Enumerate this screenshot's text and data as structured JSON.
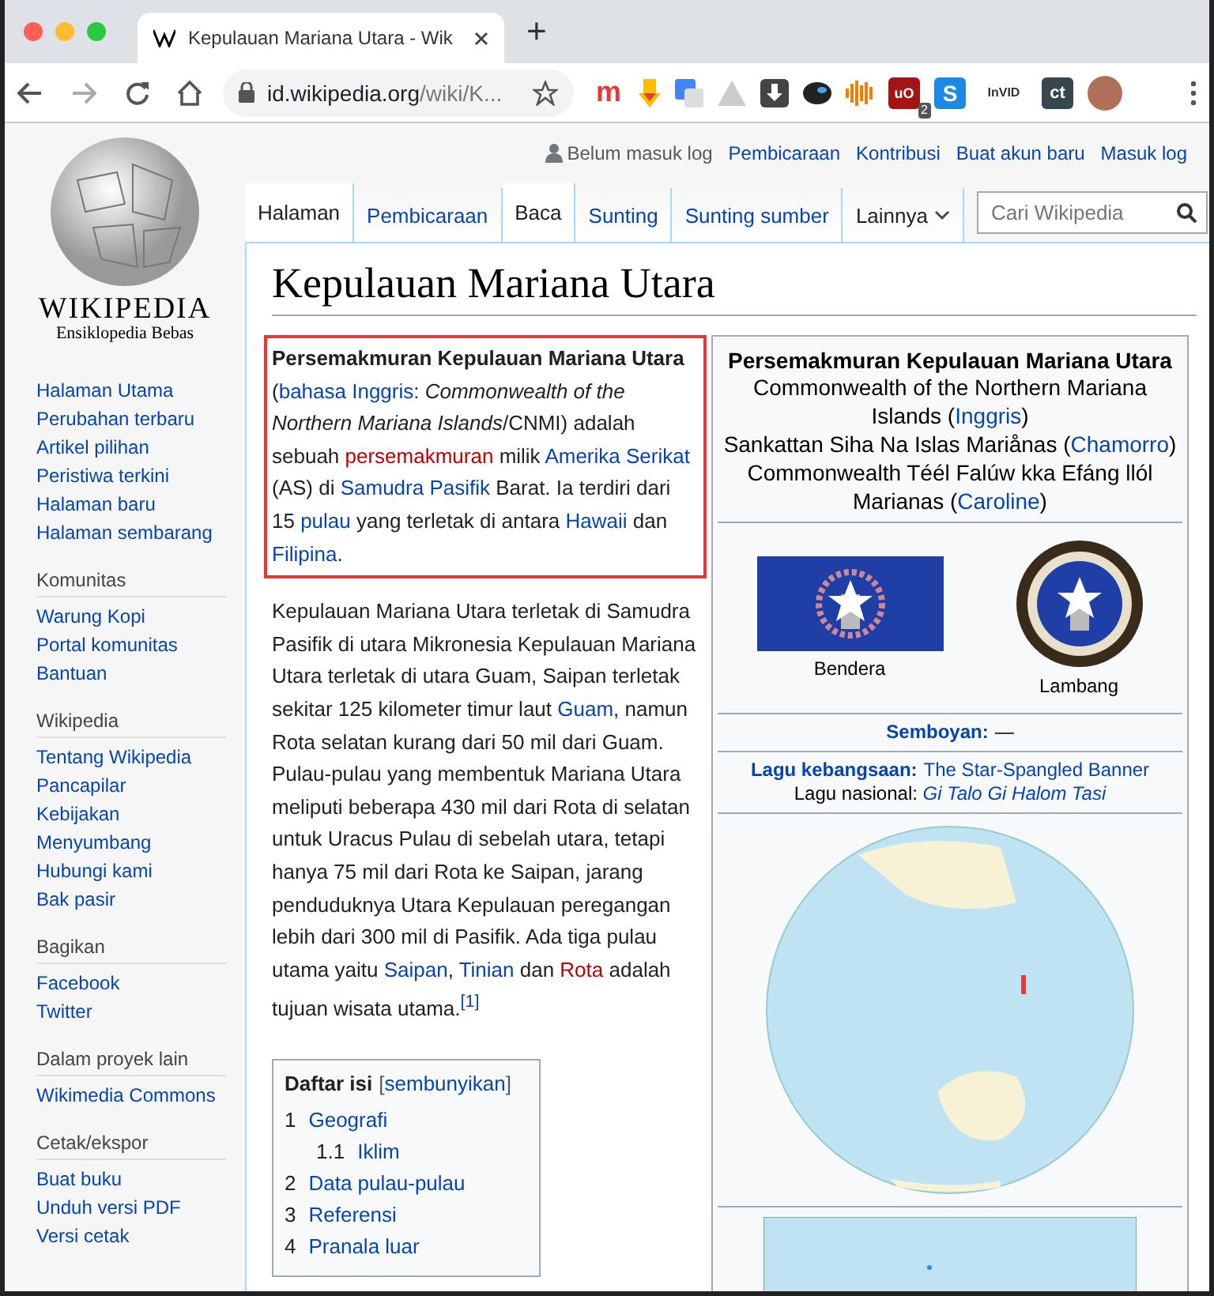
{
  "browser": {
    "tab": {
      "title": "Kepulauan Mariana Utara - Wik",
      "selected": true
    },
    "new_tab": "+",
    "url_host": "id.wikipedia.org",
    "url_path": "/wiki/K...",
    "extensions": [
      {
        "kind": "letter",
        "label": "m"
      },
      {
        "kind": "bookmark"
      },
      {
        "kind": "translate"
      },
      {
        "kind": "drive"
      },
      {
        "kind": "download"
      },
      {
        "kind": "bubble"
      },
      {
        "kind": "audio"
      },
      {
        "kind": "shield",
        "label": "uO",
        "badge": "2"
      },
      {
        "kind": "square",
        "label": "S"
      },
      {
        "kind": "text",
        "label": "InVID"
      },
      {
        "kind": "dark",
        "label": "ct"
      },
      {
        "kind": "avatar"
      }
    ]
  },
  "logo": {
    "wordmark": "WIKIPEDIA",
    "tagline": "Ensiklopedia Bebas"
  },
  "sidebar": [
    {
      "items": [
        "Halaman Utama",
        "Perubahan terbaru",
        "Artikel pilihan",
        "Peristiwa terkini",
        "Halaman baru",
        "Halaman sembarang"
      ]
    },
    {
      "heading": "Komunitas",
      "items": [
        "Warung Kopi",
        "Portal komunitas",
        "Bantuan"
      ]
    },
    {
      "heading": "Wikipedia",
      "items": [
        "Tentang Wikipedia",
        "Pancapilar",
        "Kebijakan",
        "Menyumbang",
        "Hubungi kami",
        "Bak pasir"
      ]
    },
    {
      "heading": "Bagikan",
      "items": [
        "Facebook",
        "Twitter"
      ]
    },
    {
      "heading": "Dalam proyek lain",
      "items": [
        "Wikimedia Commons"
      ]
    },
    {
      "heading": "Cetak/ekspor",
      "items": [
        "Buat buku",
        "Unduh versi PDF",
        "Versi cetak"
      ]
    }
  ],
  "personal": {
    "status": "Belum masuk log",
    "links": [
      "Pembicaraan",
      "Kontribusi",
      "Buat akun baru",
      "Masuk log"
    ]
  },
  "tabs_left": [
    {
      "label": "Halaman",
      "selected": true
    },
    {
      "label": "Pembicaraan",
      "selected": false
    }
  ],
  "tabs_right": [
    {
      "label": "Baca",
      "selected": true,
      "kind": "tab"
    },
    {
      "label": "Sunting",
      "selected": false,
      "kind": "tab"
    },
    {
      "label": "Sunting sumber",
      "selected": false,
      "kind": "tab"
    },
    {
      "label": "Lainnya",
      "selected": false,
      "kind": "menu"
    }
  ],
  "search": {
    "placeholder": "Cari Wikipedia"
  },
  "title": "Kepulauan Mariana Utara",
  "paragraphs": [
    {
      "highlighted": true,
      "segments": [
        {
          "kind": "text",
          "text": "**Persemakmuran Kepulauan Mariana Utara** ("
        },
        {
          "kind": "link",
          "text": "bahasa Inggris"
        },
        {
          "kind": "text",
          "text": ": *Commonwealth of the Northern Mariana Islands*/CNMI) adalah sebuah "
        },
        {
          "kind": "redlink",
          "text": "persemakmuran"
        },
        {
          "kind": "text",
          "text": " milik "
        },
        {
          "kind": "link",
          "text": "Amerika Serikat"
        },
        {
          "kind": "text",
          "text": " (AS) di "
        },
        {
          "kind": "link",
          "text": "Samudra Pasifik"
        },
        {
          "kind": "text",
          "text": " Barat. Ia terdiri dari 15 "
        },
        {
          "kind": "link",
          "text": "pulau"
        },
        {
          "kind": "text",
          "text": " yang terletak di antara "
        },
        {
          "kind": "link",
          "text": "Hawaii"
        },
        {
          "kind": "text",
          "text": " dan "
        },
        {
          "kind": "link",
          "text": "Filipina"
        },
        {
          "kind": "text",
          "text": "."
        }
      ]
    },
    {
      "highlighted": false,
      "segments": [
        {
          "kind": "text",
          "text": "Kepulauan Mariana Utara terletak di Samudra Pasifik di utara Mikronesia Kepulauan Mariana Utara terletak di utara Guam, Saipan terletak sekitar 125 kilometer timur laut "
        },
        {
          "kind": "link",
          "text": "Guam"
        },
        {
          "kind": "text",
          "text": ", namun Rota selatan kurang dari 50 mil dari Guam. Pulau-pulau yang membentuk Mariana Utara meliputi beberapa 430 mil dari Rota di selatan untuk Uracus Pulau di sebelah utara, tetapi hanya 75 mil dari Rota ke Saipan, jarang penduduknya Utara Kepulauan peregangan lebih dari 300 mil di Pasifik. Ada tiga pulau utama yaitu "
        },
        {
          "kind": "link",
          "text": "Saipan"
        },
        {
          "kind": "text",
          "text": ", "
        },
        {
          "kind": "link",
          "text": "Tinian"
        },
        {
          "kind": "text",
          "text": " dan "
        },
        {
          "kind": "redlink",
          "text": "Rota"
        },
        {
          "kind": "text",
          "text": " adalah tujuan wisata utama."
        },
        {
          "kind": "ref",
          "text": "[1]"
        }
      ]
    }
  ],
  "toc": {
    "title": "Daftar isi",
    "bracket_open": "[",
    "toggle": "sembunyikan",
    "bracket_close": "]",
    "entries": [
      {
        "number": "1",
        "label": "Geografi",
        "children": [
          {
            "number": "1.1",
            "label": "Iklim"
          }
        ]
      },
      {
        "number": "2",
        "label": "Data pulau-pulau"
      },
      {
        "number": "3",
        "label": "Referensi"
      },
      {
        "number": "4",
        "label": "Pranala luar"
      }
    ]
  },
  "infobox": {
    "title": "Persemakmuran Kepulauan Mariana Utara",
    "names": [
      [
        {
          "kind": "text",
          "text": "Commonwealth of the Northern Mariana Islands ("
        },
        {
          "kind": "link",
          "text": "Inggris"
        },
        {
          "kind": "text",
          "text": ")"
        }
      ],
      [
        {
          "kind": "text",
          "text": "Sankattan Siha Na Islas Mariånas ("
        },
        {
          "kind": "link",
          "text": "Chamorro"
        },
        {
          "kind": "text",
          "text": ")"
        }
      ],
      [
        {
          "kind": "text",
          "text": "Commonwealth Téél Falúw kka Efáng llól Marianas ("
        },
        {
          "kind": "link",
          "text": "Caroline"
        },
        {
          "kind": "text",
          "text": ")"
        }
      ]
    ],
    "images": [
      {
        "kind": "flag",
        "caption": "Bendera"
      },
      {
        "kind": "seal",
        "caption": "Lambang"
      }
    ],
    "motto": [
      {
        "kind": "boldlink",
        "text": "Semboyan:"
      },
      {
        "kind": "text",
        "text": "—"
      }
    ],
    "anthem": [
      [
        {
          "kind": "boldlink",
          "text": "Lagu kebangsaan:"
        },
        {
          "kind": "link",
          "text": "The Star-Spangled Banner"
        }
      ],
      [
        {
          "kind": "text",
          "text": "Lagu nasional: "
        },
        {
          "kind": "link",
          "text": "*Gi Talo Gi Halom Tasi*"
        }
      ]
    ]
  }
}
